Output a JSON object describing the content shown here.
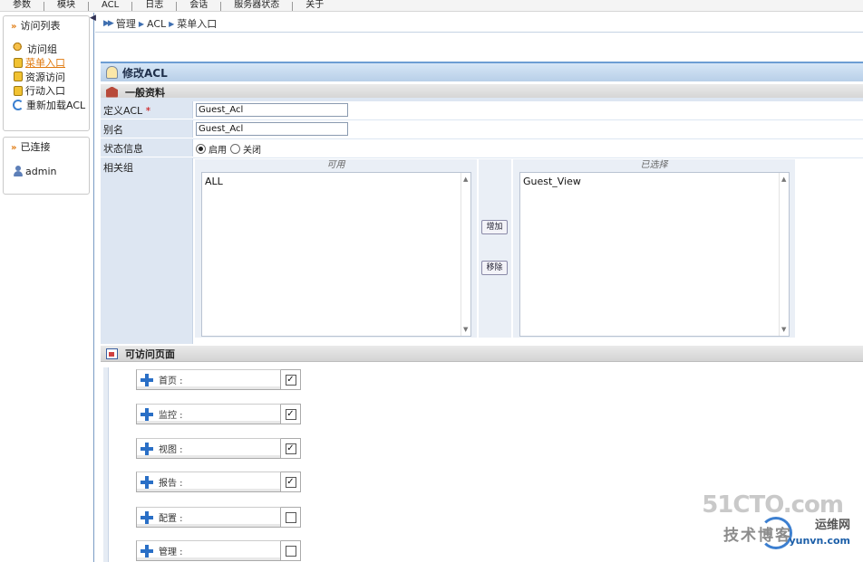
{
  "topmenu": [
    "参数",
    "模块",
    "ACL",
    "日志",
    "会话",
    "服务器状态",
    "关于"
  ],
  "sidebar": {
    "access_title": "访问列表",
    "items": [
      {
        "label": "访问组",
        "icon": "group-icon"
      },
      {
        "label": "菜单入口",
        "icon": "lock-icon"
      },
      {
        "label": "资源访问",
        "icon": "lock-icon"
      },
      {
        "label": "行动入口",
        "icon": "lock-icon"
      },
      {
        "label": "重新加载ACL",
        "icon": "reload-icon"
      }
    ],
    "connected_title": "已连接",
    "connected_user": "admin"
  },
  "breadcrumb": [
    "管理",
    "ACL",
    "菜单入口"
  ],
  "header": {
    "title": "修改ACL"
  },
  "general": {
    "title": "一般资料",
    "acl_label": "定义ACL",
    "acl_required": "*",
    "acl_value": "Guest_Acl",
    "alias_label": "别名",
    "alias_value": "Guest_Acl",
    "status_label": "状态信息",
    "status_on": "启用",
    "status_off": "关闭",
    "status_selected": "启用",
    "groups_label": "相关组",
    "available_title": "可用",
    "available_items": [
      "ALL"
    ],
    "selected_title": "已选择",
    "selected_items": [
      "Guest_View"
    ],
    "add_button": "增加",
    "remove_button": "移除"
  },
  "pages": {
    "title": "可访问页面",
    "items": [
      {
        "label": "首页 :",
        "checked": true
      },
      {
        "label": "监控 :",
        "checked": true
      },
      {
        "label": "视图 :",
        "checked": true
      },
      {
        "label": "报告 :",
        "checked": true
      },
      {
        "label": "配置 :",
        "checked": false
      },
      {
        "label": "管理 :",
        "checked": false
      }
    ]
  },
  "watermark": {
    "line1": "51CTO.com",
    "line2": "技术博客",
    "line3": "运维网",
    "line4": "yunvn.com"
  }
}
